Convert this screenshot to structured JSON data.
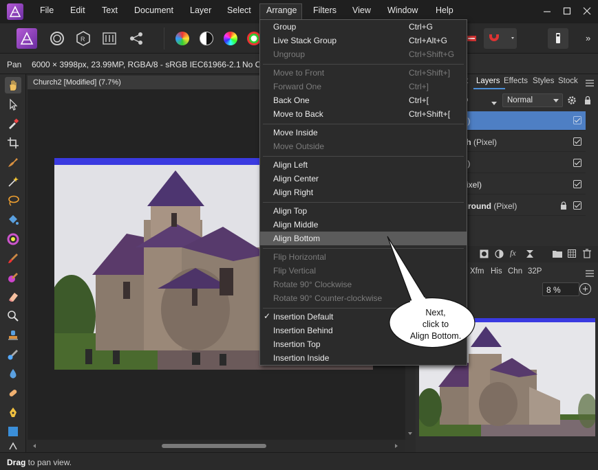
{
  "menubar": {
    "items": [
      "File",
      "Edit",
      "Text",
      "Document",
      "Layer",
      "Select",
      "Arrange",
      "Filters",
      "View",
      "Window",
      "Help"
    ],
    "window_controls": [
      "minimize-icon",
      "maximize-icon",
      "close-icon"
    ]
  },
  "toolbar": {
    "icons": [
      "photo-persona-icon",
      "liquify-persona-icon",
      "develop-persona-icon",
      "tone-mapping-persona-icon",
      "export-persona-icon",
      "auto-levels-icon",
      "auto-contrast-icon",
      "auto-colors-icon",
      "auto-white-balance-icon",
      "snapping-magnet-icon",
      "assistant-icon",
      "overflow-icon"
    ],
    "overflow_label": "»"
  },
  "contextbar": {
    "tool": "Pan",
    "doc_info": "6000 × 3998px, 23.99MP, RGBA/8 - sRGB IEC61966-2.1",
    "extra": "No C"
  },
  "document": {
    "tab_title": "Church2 [Modified] (7.7%)"
  },
  "arrange_menu": {
    "items": [
      {
        "label": "Group",
        "shortcut": "Ctrl+G",
        "enabled": true
      },
      {
        "label": "Live Stack Group",
        "shortcut": "Ctrl+Alt+G",
        "enabled": true
      },
      {
        "label": "Ungroup",
        "shortcut": "Ctrl+Shift+G",
        "enabled": false
      },
      {
        "label": "Move to Front",
        "shortcut": "Ctrl+Shift+]",
        "enabled": false
      },
      {
        "label": "Forward One",
        "shortcut": "Ctrl+]",
        "enabled": false
      },
      {
        "label": "Back One",
        "shortcut": "Ctrl+[",
        "enabled": true
      },
      {
        "label": "Move to Back",
        "shortcut": "Ctrl+Shift+[",
        "enabled": true
      },
      {
        "label": "Move Inside",
        "shortcut": "",
        "enabled": true
      },
      {
        "label": "Move Outside",
        "shortcut": "",
        "enabled": false
      },
      {
        "label": "Align Left",
        "shortcut": "",
        "enabled": true
      },
      {
        "label": "Align Center",
        "shortcut": "",
        "enabled": true
      },
      {
        "label": "Align Right",
        "shortcut": "",
        "enabled": true
      },
      {
        "label": "Align Top",
        "shortcut": "",
        "enabled": true
      },
      {
        "label": "Align Middle",
        "shortcut": "",
        "enabled": true
      },
      {
        "label": "Align Bottom",
        "shortcut": "",
        "enabled": true,
        "highlighted": true
      },
      {
        "label": "Flip Horizontal",
        "shortcut": "",
        "enabled": false
      },
      {
        "label": "Flip Vertical",
        "shortcut": "",
        "enabled": false
      },
      {
        "label": "Rotate 90° Clockwise",
        "shortcut": "",
        "enabled": false
      },
      {
        "label": "Rotate 90° Counter-clockwise",
        "shortcut": "",
        "enabled": false
      },
      {
        "label": "Insertion Default",
        "shortcut": "",
        "enabled": true,
        "checked": true
      },
      {
        "label": "Insertion Behind",
        "shortcut": "",
        "enabled": true
      },
      {
        "label": "Insertion Top",
        "shortcut": "",
        "enabled": true
      },
      {
        "label": "Insertion Inside",
        "shortcut": "",
        "enabled": true
      }
    ]
  },
  "panels": {
    "tabs": [
      "t",
      "Layers",
      "Effects",
      "Styles",
      "Stock"
    ],
    "active_tab": "Layers",
    "opacity_partial": "%",
    "blend_mode": "Normal",
    "layers": [
      {
        "name": "ge)",
        "type": "",
        "bold": false,
        "selected": true,
        "locked": false
      },
      {
        "name": "rch",
        "type": "(Pixel)",
        "bold": true,
        "selected": false,
        "locked": false
      },
      {
        "name": "ge)",
        "type": "",
        "bold": false,
        "selected": false,
        "locked": false
      },
      {
        "name": "(Pixel)",
        "type": "",
        "bold": false,
        "selected": false,
        "locked": false
      },
      {
        "name": "kground",
        "type": "(Pixel)",
        "bold": true,
        "selected": false,
        "locked": true
      }
    ],
    "nav_tabs": [
      "Xfm",
      "His",
      "Chn",
      "32P"
    ],
    "zoom": "8 %"
  },
  "callout": {
    "text": [
      "Next,",
      "click to",
      "Align Bottom."
    ]
  },
  "status": {
    "action": "Drag",
    "rest": " to pan view."
  },
  "colors": {
    "accent": "#4e7fc4",
    "menu_highlight": "#5b5b5b",
    "persona": "#9b46c9"
  }
}
